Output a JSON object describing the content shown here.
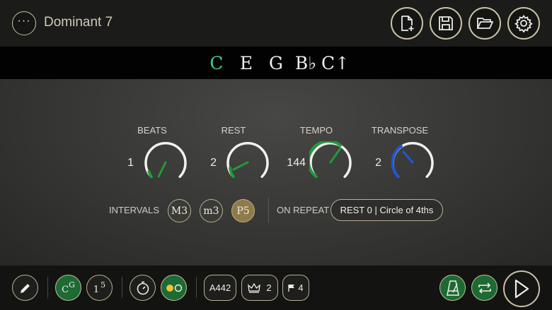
{
  "header": {
    "menu_glyph": "···",
    "title": "Dominant 7",
    "buttons": [
      "new-file-icon",
      "save-icon",
      "open-folder-icon",
      "settings-icon"
    ]
  },
  "notes": [
    {
      "label": "C",
      "active": true
    },
    {
      "label": "E",
      "active": false
    },
    {
      "label": "G",
      "active": false
    },
    {
      "label": "B♭",
      "active": false
    },
    {
      "label": "C↑",
      "active": false
    }
  ],
  "knobs": {
    "beats": {
      "label": "BEATS",
      "value": "1"
    },
    "rest": {
      "label": "REST",
      "value": "2"
    },
    "tempo": {
      "label": "TEMPO",
      "value": "144"
    },
    "transpose": {
      "label": "TRANSPOSE",
      "value": "2"
    }
  },
  "intervals": {
    "label": "INTERVALS",
    "items": [
      {
        "label": "M3",
        "active": false
      },
      {
        "label": "m3",
        "active": false
      },
      {
        "label": "P5",
        "active": true
      }
    ]
  },
  "repeat": {
    "label": "ON REPEAT",
    "value": "REST 0 | Circle of 4ths"
  },
  "bottom": {
    "chord_mode": {
      "base": "C",
      "sup": "G"
    },
    "degree_mode": {
      "base": "1",
      "sup": "5"
    },
    "tuning": "A442",
    "crown_count": "2",
    "flag_count": "4"
  },
  "colors": {
    "accent_green": "#3dd08f",
    "knob_green": "#1f9a3c",
    "knob_blue": "#1e57d6",
    "active_gold": "#8e7a4a",
    "border_gold": "#c9c2a6"
  }
}
